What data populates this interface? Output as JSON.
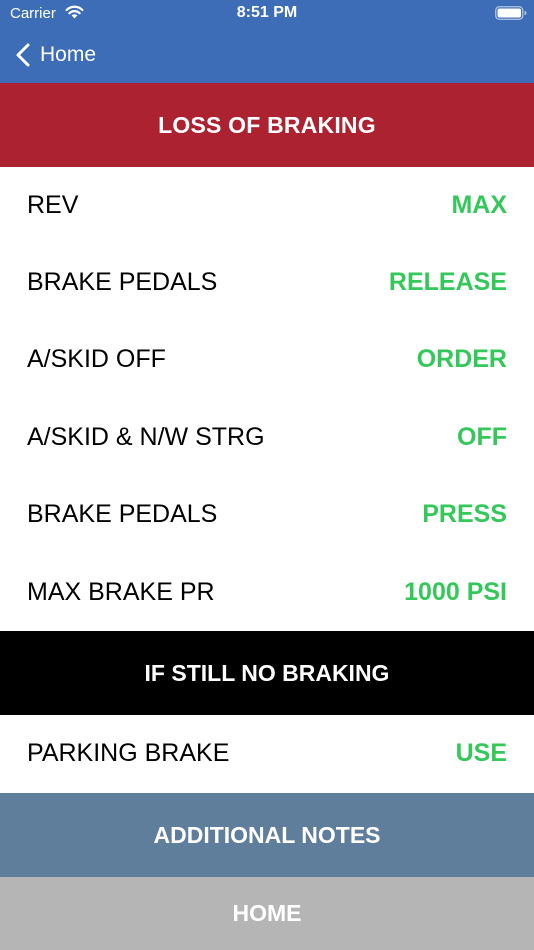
{
  "status_bar": {
    "carrier": "Carrier",
    "time": "8:51 PM"
  },
  "nav": {
    "back_label": "Home"
  },
  "title": "LOSS OF BRAKING",
  "steps": [
    {
      "label": "REV",
      "value": "MAX"
    },
    {
      "label": "BRAKE PEDALS",
      "value": "RELEASE"
    },
    {
      "label": "A/SKID OFF",
      "value": "ORDER"
    },
    {
      "label": "A/SKID & N/W STRG",
      "value": "OFF"
    },
    {
      "label": "BRAKE PEDALS",
      "value": "PRESS"
    },
    {
      "label": "MAX BRAKE PR",
      "value": "1000 PSI"
    }
  ],
  "subheader": "IF STILL NO BRAKING",
  "steps2": [
    {
      "label": "PARKING BRAKE",
      "value": "USE"
    }
  ],
  "buttons": {
    "notes": "ADDITIONAL NOTES",
    "home": "HOME"
  },
  "colors": {
    "nav_bg": "#3c6db6",
    "header_red": "#ad2230",
    "value_green": "#34c759",
    "notes_bg": "#5e7e9b",
    "home_bg": "#b5b5b5"
  },
  "icons": {
    "wifi": "wifi-icon",
    "battery": "battery-icon",
    "back": "chevron-left-icon"
  }
}
